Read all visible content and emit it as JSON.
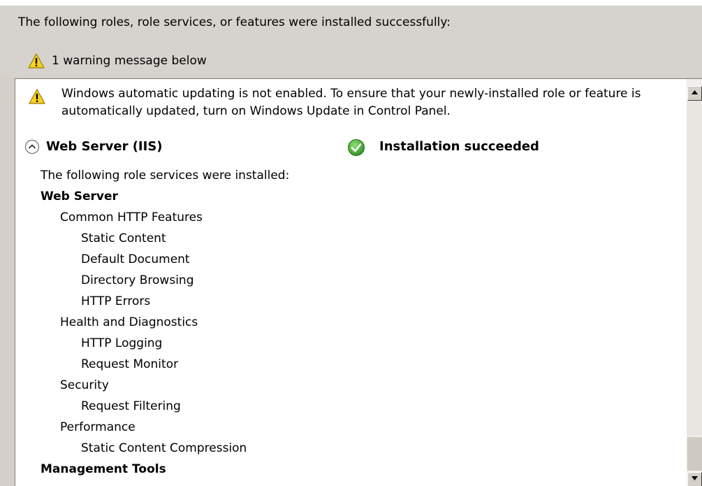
{
  "header": {
    "summary_text": "The following roles, role services, or features were installed successfully:",
    "warning_count_text": "1 warning message below"
  },
  "results": {
    "update_warning": {
      "line1": "Windows automatic updating is not enabled. To ensure that your newly-installed role or feature is",
      "line2": "automatically updated, turn on Windows Update in Control Panel."
    },
    "role": {
      "name": "Web Server (IIS)",
      "status": "Installation succeeded"
    },
    "items": [
      {
        "text": "The following role services were installed:",
        "level": 0,
        "bold": false
      },
      {
        "text": "Web Server",
        "level": 0,
        "bold": true
      },
      {
        "text": "Common HTTP Features",
        "level": 1,
        "bold": false
      },
      {
        "text": "Static Content",
        "level": 2,
        "bold": false
      },
      {
        "text": "Default Document",
        "level": 2,
        "bold": false
      },
      {
        "text": "Directory Browsing",
        "level": 2,
        "bold": false
      },
      {
        "text": "HTTP Errors",
        "level": 2,
        "bold": false
      },
      {
        "text": "Health and Diagnostics",
        "level": 1,
        "bold": false
      },
      {
        "text": "HTTP Logging",
        "level": 2,
        "bold": false
      },
      {
        "text": "Request Monitor",
        "level": 2,
        "bold": false
      },
      {
        "text": "Security",
        "level": 1,
        "bold": false
      },
      {
        "text": "Request Filtering",
        "level": 2,
        "bold": false
      },
      {
        "text": "Performance",
        "level": 1,
        "bold": false
      },
      {
        "text": "Static Content Compression",
        "level": 2,
        "bold": false
      },
      {
        "text": "Management Tools",
        "level": 0,
        "bold": true
      }
    ]
  },
  "icons": {
    "warning": "warning-icon",
    "collapse": "chevron-up-circle-icon",
    "success": "success-check-icon",
    "scroll_up": "scroll-up-arrow-icon",
    "scroll_down": "scroll-down-arrow-icon"
  },
  "colors": {
    "warning_yellow": "#f5d21f",
    "success_green": "#3ea82a",
    "dialog_gray": "#d6d3ce"
  }
}
